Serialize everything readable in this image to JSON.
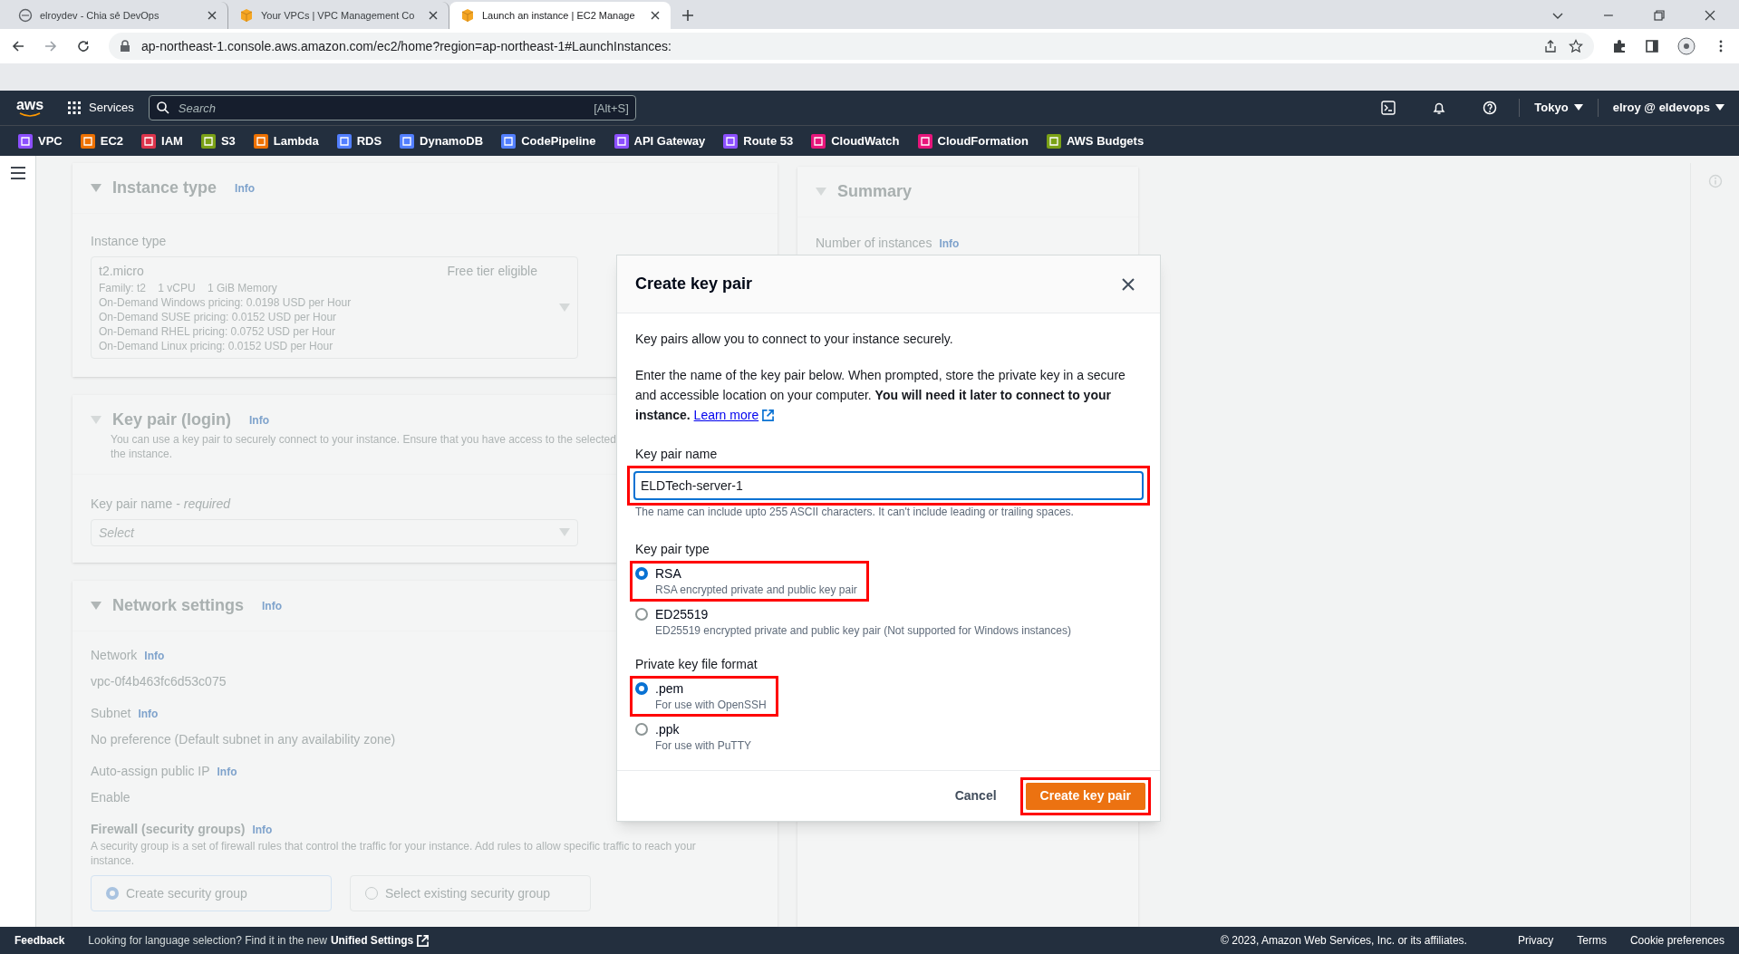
{
  "browser": {
    "tabs": [
      {
        "title": "elroydev - Chia sẻ DevOps",
        "selected": false
      },
      {
        "title": "Your VPCs | VPC Management Co",
        "selected": false
      },
      {
        "title": "Launch an instance | EC2 Manage",
        "selected": true
      }
    ],
    "url": "ap-northeast-1.console.aws.amazon.com/ec2/home?region=ap-northeast-1#LaunchInstances:"
  },
  "aws_nav": {
    "logo": "aws",
    "services": "Services",
    "search_placeholder": "Search",
    "shortcut": "[Alt+S]",
    "region": "Tokyo",
    "account": "elroy @ eldevops"
  },
  "favorites": [
    {
      "label": "VPC",
      "color": "#8c4fff"
    },
    {
      "label": "EC2",
      "color": "#ed7100"
    },
    {
      "label": "IAM",
      "color": "#dd344c"
    },
    {
      "label": "S3",
      "color": "#7aa116"
    },
    {
      "label": "Lambda",
      "color": "#ed7100"
    },
    {
      "label": "RDS",
      "color": "#527fff"
    },
    {
      "label": "DynamoDB",
      "color": "#527fff"
    },
    {
      "label": "CodePipeline",
      "color": "#527fff"
    },
    {
      "label": "API Gateway",
      "color": "#8c4fff"
    },
    {
      "label": "Route 53",
      "color": "#8c4fff"
    },
    {
      "label": "CloudWatch",
      "color": "#e7157b"
    },
    {
      "label": "CloudFormation",
      "color": "#e7157b"
    },
    {
      "label": "AWS Budgets",
      "color": "#7aa116"
    }
  ],
  "background": {
    "instance_type": {
      "title": "Instance type",
      "info": "Info",
      "label": "Instance type",
      "value": "t2.micro",
      "badge": "Free tier eligible",
      "details": [
        "Family: t2    1 vCPU    1 GiB Memory",
        "On-Demand Windows pricing: 0.0198 USD per Hour",
        "On-Demand SUSE pricing: 0.0152 USD per Hour",
        "On-Demand RHEL pricing: 0.0752 USD per Hour",
        "On-Demand Linux pricing: 0.0152 USD per Hour"
      ]
    },
    "key_pair": {
      "title": "Key pair (login)",
      "info": "Info",
      "description": [
        "You can use a key pair to securely connect to your instance. Ensure that you have access to the selected",
        "the instance."
      ],
      "label": "Key pair name - *required*",
      "placeholder": "Select"
    },
    "network": {
      "title": "Network settings",
      "info": "Info",
      "fields": [
        {
          "label": "Network",
          "info": "Info",
          "value": "vpc-0f4b463fc6d53c075"
        },
        {
          "label": "Subnet",
          "info": "Info",
          "value": "No preference (Default subnet in any availability zone)"
        },
        {
          "label": "Auto-assign public IP",
          "info": "Info",
          "value": "Enable"
        }
      ],
      "firewall": {
        "label": "Firewall (security groups)",
        "info": "Info",
        "description": "A security group is a set of firewall rules that control the traffic for your instance. Add rules to allow specific traffic to reach your instance.",
        "options": [
          {
            "label": "Create security group",
            "selected": true
          },
          {
            "label": "Select existing security group",
            "selected": false
          }
        ]
      }
    },
    "summary": {
      "title": "Summary",
      "label": "Number of instances",
      "info": "Info"
    }
  },
  "modal": {
    "title": "Create key pair",
    "intro": "Key pairs allow you to connect to your instance securely.",
    "description": "Enter the name of the key pair below. When prompted, store the private key in a secure and accessible location on your computer. **You will need it later to connect to your instance.**",
    "link": "Learn more",
    "name_label": "Key pair name",
    "name_value": "ELDTech-server-1",
    "name_highlighted": true,
    "name_hint": "The name can include upto 255 ASCII characters. It can't include leading or trailing spaces.",
    "type_label": "Key pair type",
    "type_options": [
      {
        "label": "RSA",
        "description": "RSA encrypted private and public key pair",
        "selected": true,
        "highlighted": true
      },
      {
        "label": "ED25519",
        "description": "ED25519 encrypted private and public key pair (Not supported for Windows instances)",
        "selected": false,
        "highlighted": false
      }
    ],
    "format_label": "Private key file format",
    "format_options": [
      {
        "label": ".pem",
        "description": "For use with OpenSSH",
        "selected": true,
        "highlighted": true
      },
      {
        "label": ".ppk",
        "description": "For use with PuTTY",
        "selected": false,
        "highlighted": false
      }
    ],
    "cancel": "Cancel",
    "submit": {
      "label": "Create key pair",
      "highlighted": true
    }
  },
  "footer": {
    "feedback": "Feedback",
    "language_text": "Looking for language selection? Find it in the new",
    "language_link": "Unified Settings",
    "copyright": "© 2023, Amazon Web Services, Inc. or its affiliates.",
    "links": [
      "Privacy",
      "Terms",
      "Cookie preferences"
    ]
  }
}
